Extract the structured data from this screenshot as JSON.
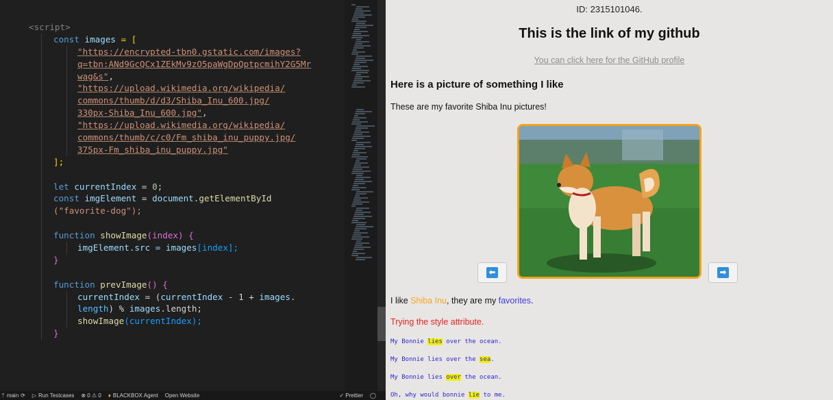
{
  "editor": {
    "script_open": "<script>",
    "lines": {
      "l2_kw": "const",
      "l2_var": "images",
      "l2_rest": " = [",
      "url1_a": "\"https://encrypted-tbn0.gstatic.com/images?",
      "url1_b": "q=tbn:ANd9GcQCx1ZEkMv9zO5paWgDpQptpcmihY2G5Mr",
      "url1_c": "wag&s\"",
      "url2_a": "\"https://upload.wikimedia.org/wikipedia/",
      "url2_b": "commons/thumb/d/d3/Shiba_Inu_600.jpg/",
      "url2_c": "330px-Shiba_Inu_600.jpg\"",
      "url3_a": "\"https://upload.wikimedia.org/wikipedia/",
      "url3_b": "commons/thumb/c/c0/Fm_shiba_inu_puppy.jpg/",
      "url3_c": "375px-Fm_shiba_inu_puppy.jpg\"",
      "close_arr": "];",
      "let_kw": "let",
      "cur_var": "currentIndex",
      "cur_rest": " = ",
      "zero": "0",
      "semi": ";",
      "const_kw": "const",
      "img_var": "imgElement",
      "eq": " = ",
      "doc": "document",
      "dot": ".",
      "gebi": "getElementById",
      "fav_arg": "(\"favorite-dog\");",
      "fn_kw": "function",
      "show_fn": "showImage",
      "show_params": "(index) {",
      "img_src_a": "imgElement",
      "img_src_b": ".src = ",
      "img_src_c": "images",
      "img_src_d": "[index];",
      "close_brace": "}",
      "prev_fn": "prevImage",
      "prev_params": "() {",
      "ci_a": "currentIndex",
      "ci_b": " = (",
      "ci_c": "currentIndex",
      "ci_d": " - 1 + ",
      "ci_e": "images",
      "ci_f": ".",
      "len_a": "length",
      "len_b": ") % ",
      "len_c": "images",
      "len_d": ".length;",
      "show_call": "showImage",
      "show_call_args": "(currentIndex);"
    }
  },
  "statusbar": {
    "branch": "main",
    "run_tests": "Run Testcases",
    "problems": "⊗ 0 ⚠ 0",
    "blackbox": "BLACKBOX Agent",
    "open_website": "Open Website",
    "prettier": "✓ Prettier"
  },
  "browser": {
    "student_id": "ID: 2315101046.",
    "github_heading": "This is the link of my github",
    "github_link": "You can click here for the GitHub profile",
    "pic_heading": "Here is a picture of something I like",
    "pic_desc": "These are my favorite Shiba Inu pictures!",
    "like_a": "I like ",
    "like_b": "Shiba Inu",
    "like_c": ", they are my ",
    "like_d": "favorites",
    "like_e": ".",
    "style_line": "Trying the style attribute.",
    "poem": [
      {
        "pre": "My Bonnie ",
        "hl": "lies",
        "post": " over the ocean."
      },
      {
        "pre": "My Bonnie lies over the ",
        "hl": "sea",
        "post": "."
      },
      {
        "pre": "My Bonnie lies ",
        "hl": "over",
        "post": " the ocean."
      },
      {
        "pre": "Oh, why would bonnie ",
        "hl": "lie",
        "post": " to me."
      }
    ],
    "prev_icon": "⬅",
    "next_icon": "➡"
  },
  "colors": {
    "accent_frame": "#f2a31b",
    "button_icon": "#2f8fdc",
    "editor_bg": "#1f1f1f",
    "page_bg": "#e8e6e5"
  }
}
